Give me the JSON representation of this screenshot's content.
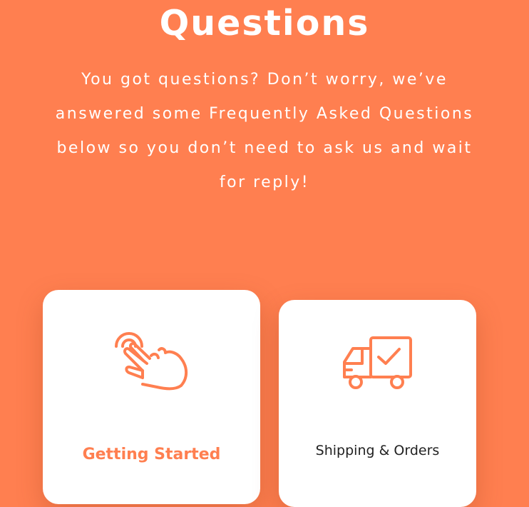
{
  "hero": {
    "title": "Questions",
    "subtitle": "You got questions? Don’t worry, we’ve answered some Frequently Asked Questions below so you don’t need to ask us and wait for reply!"
  },
  "cards": [
    {
      "label": "Getting Started",
      "icon": "hand-pointer-icon"
    },
    {
      "label": "Shipping & Orders",
      "icon": "delivery-truck-icon"
    }
  ],
  "colors": {
    "background": "#ff7f50",
    "accent": "#ff7f50",
    "card": "#ffffff",
    "text_dark": "#222222"
  }
}
